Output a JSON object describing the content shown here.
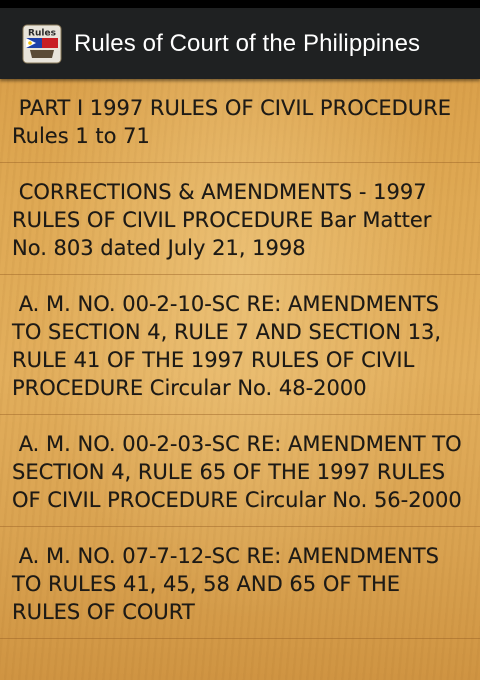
{
  "action_bar": {
    "title": "Rules of Court of the Philippines",
    "icon": "rules-of-court-app-icon",
    "icon_text": "Rules"
  },
  "colors": {
    "action_bar_bg": "#1f2122",
    "status_bar_bg": "#000000",
    "paper_bg": "#dfa954",
    "item_text": "#1d1a16"
  },
  "items": [
    {
      "label": " PART I 1997 RULES OF CIVIL PROCEDURE Rules 1 to 71"
    },
    {
      "label": " CORRECTIONS & AMENDMENTS - 1997 RULES OF CIVIL PROCEDURE Bar Matter No. 803 dated July 21, 1998"
    },
    {
      "label": " A. M. NO. 00-2-10-SC RE: AMENDMENTS TO SECTION 4, RULE 7 AND SECTION 13, RULE 41 OF THE 1997 RULES OF CIVIL PROCEDURE Circular No. 48-2000"
    },
    {
      "label": " A. M. NO. 00-2-03-SC RE: AMENDMENT TO SECTION 4, RULE 65 OF THE 1997 RULES OF CIVIL PROCEDURE Circular No. 56-2000"
    },
    {
      "label": " A. M. NO. 07-7-12-SC RE: AMENDMENTS TO RULES 41, 45, 58 AND 65 OF THE RULES OF COURT"
    }
  ]
}
